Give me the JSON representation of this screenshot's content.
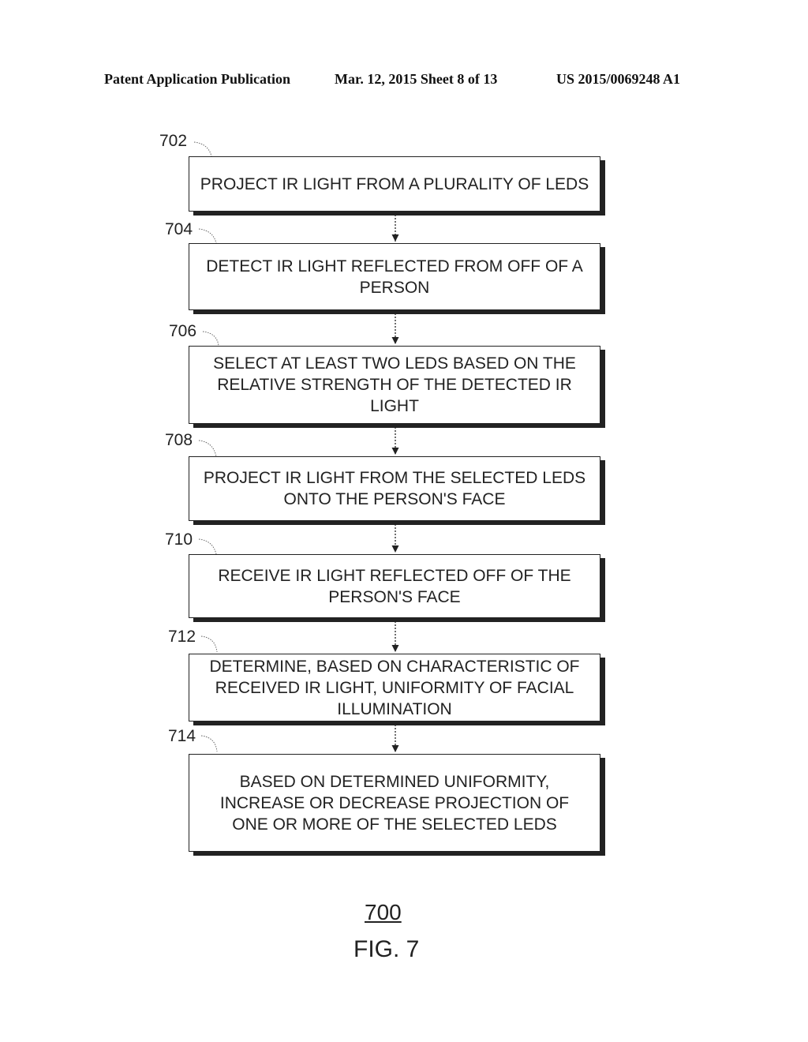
{
  "header": {
    "publication": "Patent Application Publication",
    "date_sheet": "Mar. 12, 2015  Sheet 8 of 13",
    "number": "US 2015/0069248 A1"
  },
  "steps": [
    {
      "ref": "702",
      "text": "PROJECT IR LIGHT FROM A PLURALITY OF LEDS"
    },
    {
      "ref": "704",
      "text": "DETECT IR LIGHT REFLECTED FROM OFF OF A PERSON"
    },
    {
      "ref": "706",
      "text": "SELECT AT LEAST TWO LEDS BASED ON THE RELATIVE STRENGTH OF THE DETECTED IR LIGHT"
    },
    {
      "ref": "708",
      "text": "PROJECT IR LIGHT FROM THE SELECTED LEDS ONTO THE PERSON'S FACE"
    },
    {
      "ref": "710",
      "text": "RECEIVE IR LIGHT REFLECTED OFF OF THE PERSON'S FACE"
    },
    {
      "ref": "712",
      "text": "DETERMINE, BASED ON CHARACTERISTIC OF RECEIVED IR LIGHT, UNIFORMITY OF FACIAL ILLUMINATION"
    },
    {
      "ref": "714",
      "text": "BASED ON DETERMINED UNIFORMITY, INCREASE OR DECREASE PROJECTION OF ONE OR MORE OF THE SELECTED LEDS"
    }
  ],
  "figure": {
    "number": "700",
    "label": "FIG. 7"
  }
}
